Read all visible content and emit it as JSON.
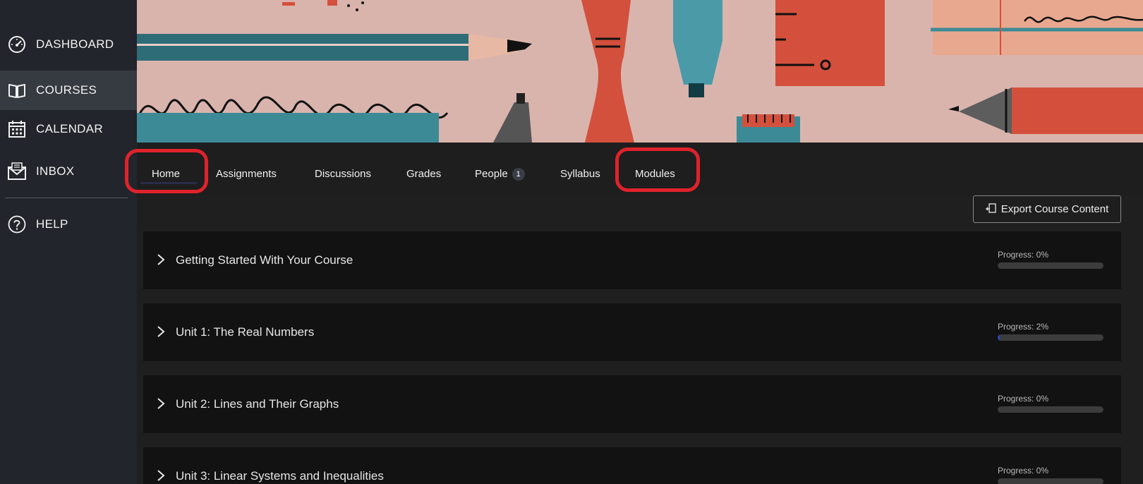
{
  "sidebar": {
    "items": [
      {
        "label": "DASHBOARD",
        "icon": "speedometer-icon",
        "active": false
      },
      {
        "label": "COURSES",
        "icon": "book-icon",
        "active": true
      },
      {
        "label": "CALENDAR",
        "icon": "calendar-icon",
        "active": false
      },
      {
        "label": "INBOX",
        "icon": "envelope-icon",
        "active": false
      }
    ],
    "help": {
      "label": "HELP",
      "icon": "help-icon"
    }
  },
  "tabs": [
    {
      "label": "Home",
      "highlighted": true
    },
    {
      "label": "Assignments"
    },
    {
      "label": "Discussions"
    },
    {
      "label": "Grades"
    },
    {
      "label": "People",
      "badge": "1"
    },
    {
      "label": "Syllabus"
    },
    {
      "label": "Modules",
      "highlighted": true
    }
  ],
  "export_button": {
    "label": "Export Course Content",
    "icon": "export-icon"
  },
  "modules": [
    {
      "title": "Getting Started With Your Course",
      "progress_label": "Progress: 0%",
      "progress": 0
    },
    {
      "title": "Unit 1: The Real Numbers",
      "progress_label": "Progress: 2%",
      "progress": 2
    },
    {
      "title": "Unit 2: Lines and Their Graphs",
      "progress_label": "Progress: 0%",
      "progress": 0
    },
    {
      "title": "Unit 3: Linear Systems and Inequalities",
      "progress_label": "Progress: 0%",
      "progress": 0
    }
  ],
  "colors": {
    "highlight": "#e0222b",
    "progress_fill": "#2a45c4",
    "sidebar_bg": "#22252b",
    "active_nav_bg": "#363a41",
    "module_bg": "#121212"
  }
}
